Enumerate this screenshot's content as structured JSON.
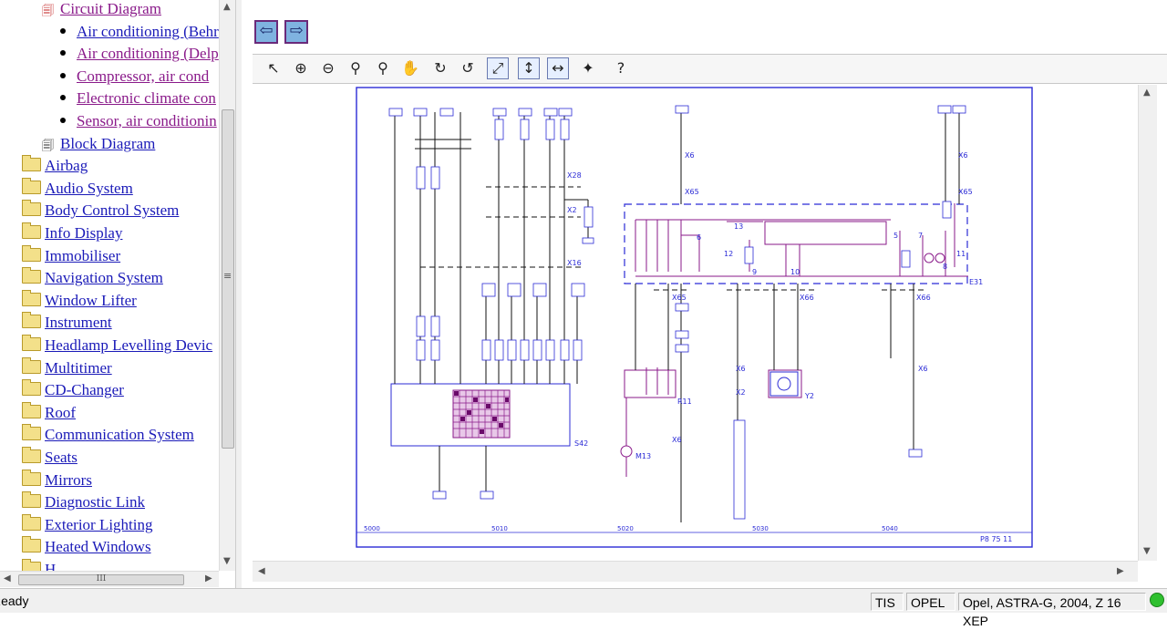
{
  "tree": {
    "items": [
      {
        "label": "Circuit Diagram",
        "kind": "doc-red",
        "color": "purple"
      },
      {
        "label": "Air conditioning (Behr",
        "kind": "bullet",
        "color": "blue"
      },
      {
        "label": "Air conditioning (Delp",
        "kind": "bullet",
        "color": "purple"
      },
      {
        "label": "Compressor, air cond",
        "kind": "bullet",
        "color": "purple"
      },
      {
        "label": "Electronic climate con",
        "kind": "bullet",
        "color": "purple"
      },
      {
        "label": "Sensor, air conditionin",
        "kind": "bullet",
        "color": "purple"
      },
      {
        "label": "Block Diagram",
        "kind": "doc",
        "color": "blue"
      },
      {
        "label": "Airbag",
        "kind": "folder",
        "color": "blue"
      },
      {
        "label": "Audio System",
        "kind": "folder",
        "color": "blue"
      },
      {
        "label": "Body Control System",
        "kind": "folder",
        "color": "blue"
      },
      {
        "label": "Info Display",
        "kind": "folder",
        "color": "blue"
      },
      {
        "label": "Immobiliser",
        "kind": "folder",
        "color": "blue"
      },
      {
        "label": "Navigation System",
        "kind": "folder",
        "color": "blue"
      },
      {
        "label": "Window Lifter",
        "kind": "folder",
        "color": "blue"
      },
      {
        "label": "Instrument",
        "kind": "folder",
        "color": "blue"
      },
      {
        "label": "Headlamp Levelling Devic",
        "kind": "folder",
        "color": "blue"
      },
      {
        "label": "Multitimer",
        "kind": "folder",
        "color": "blue"
      },
      {
        "label": "CD-Changer",
        "kind": "folder",
        "color": "blue"
      },
      {
        "label": "Roof",
        "kind": "folder",
        "color": "blue"
      },
      {
        "label": "Communication System",
        "kind": "folder",
        "color": "blue"
      },
      {
        "label": "Seats",
        "kind": "folder",
        "color": "blue"
      },
      {
        "label": "Mirrors",
        "kind": "folder",
        "color": "blue"
      },
      {
        "label": "Diagnostic Link",
        "kind": "folder",
        "color": "blue"
      },
      {
        "label": "Exterior Lighting",
        "kind": "folder",
        "color": "blue"
      },
      {
        "label": "Heated Windows",
        "kind": "folder",
        "color": "blue"
      },
      {
        "label": "H",
        "kind": "folder",
        "color": "blue"
      }
    ],
    "hscroll_grip": "III",
    "vscroll_grip": "≡"
  },
  "nav": {
    "back_icon": "arrow-left-icon",
    "forward_icon": "arrow-right-icon"
  },
  "toolbar": {
    "tools": [
      {
        "name": "select-pointer-icon",
        "glyph": "↖"
      },
      {
        "name": "zoom-in-icon",
        "glyph": "⊕"
      },
      {
        "name": "zoom-out-icon",
        "glyph": "⊖"
      },
      {
        "name": "zoom-icon",
        "glyph": "⚲"
      },
      {
        "name": "zoom-window-icon",
        "glyph": "⚲"
      },
      {
        "name": "pan-hand-icon",
        "glyph": "✋"
      },
      {
        "name": "rotate-right-icon",
        "glyph": "↻"
      },
      {
        "name": "rotate-left-icon",
        "glyph": "↺"
      },
      {
        "name": "fit-page-icon",
        "glyph": "⤢"
      },
      {
        "name": "fit-height-icon",
        "glyph": "↕"
      },
      {
        "name": "fit-width-icon",
        "glyph": "↔"
      },
      {
        "name": "highlight-icon",
        "glyph": "✦"
      },
      {
        "name": "help-icon",
        "glyph": "?"
      }
    ]
  },
  "diagram": {
    "labels": {
      "x28": "X28",
      "x2a": "X2",
      "x16": "X16",
      "s42": "S42",
      "x6a": "X6",
      "x6b": "X6",
      "x65a": "X65",
      "x65b": "X65",
      "x66a": "X66",
      "x66b": "X66",
      "x6c": "X6",
      "x2b": "X2",
      "x6d": "X6",
      "x6e": "X6",
      "e31": "E31",
      "r11": "R11",
      "m13": "M13",
      "y2": "Y2",
      "n13": "13",
      "n12": "12",
      "n6": "6",
      "n5": "5",
      "n7": "7",
      "n8": "8",
      "n9": "9",
      "n10": "10",
      "n11": "11",
      "sheet": "P8 75 11",
      "ruler_start": "5000",
      "ruler_mid1": "5010",
      "ruler_mid2": "5020",
      "ruler_mid3": "5030",
      "ruler_mid4": "5040"
    },
    "colors": {
      "frame": "#2b2bd6",
      "circuit": "#8a1a8a",
      "wire": "#111111"
    }
  },
  "status": {
    "ready": "Ready",
    "app": "TIS",
    "make": "OPEL",
    "vehicle": "Opel, ASTRA-G, 2004, Z 16 XEP",
    "led_color": "#2fc02f"
  }
}
